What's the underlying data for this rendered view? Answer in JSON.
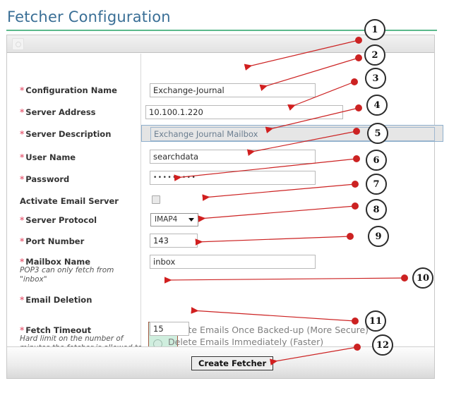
{
  "page": {
    "title": "Fetcher Configuration"
  },
  "toolbar": {
    "icon": "image-placeholder-icon"
  },
  "form": {
    "required_marker": "*",
    "fields": [
      {
        "label": "Configuration Name",
        "value": "Exchange-Journal",
        "required": true
      },
      {
        "label": "Server Address",
        "value": "10.100.1.220",
        "required": true
      },
      {
        "label": "Server Description",
        "value": "Exchange Journal Mailbox",
        "required": true,
        "focused": true
      },
      {
        "label": "User Name",
        "value": "searchdata",
        "required": true
      },
      {
        "label": "Password",
        "value": "•••••••••",
        "required": true
      },
      {
        "label": "Activate Email Server",
        "value": "",
        "required": false,
        "checked": false
      },
      {
        "label": "Server Protocol",
        "value": "IMAP4",
        "required": true
      },
      {
        "label": "Port Number",
        "value": "143",
        "required": true
      },
      {
        "label": "Mailbox Name",
        "value": "inbox",
        "required": true,
        "hint": "POP3 can only fetch from \"inbox\""
      },
      {
        "label": "Email Deletion",
        "value": "",
        "required": true
      },
      {
        "label": "Fetch Timeout",
        "value": "15",
        "required": true,
        "hint": "Hard limit on the number of minutes the fetcher is allowed to spend fetching one email."
      }
    ],
    "protocol_options": [
      "IMAP4"
    ],
    "deletion_options": [
      {
        "label": "Delete Emails Once Backed-up (More Secure)",
        "selected": true
      },
      {
        "label": "Delete Emails Immediately (Faster)",
        "selected": false
      }
    ]
  },
  "footer": {
    "submit_label": "Create Fetcher"
  },
  "annotations": {
    "accent_color": "#cc2222",
    "callouts": [
      {
        "number": "1"
      },
      {
        "number": "2"
      },
      {
        "number": "3"
      },
      {
        "number": "4"
      },
      {
        "number": "5"
      },
      {
        "number": "6"
      },
      {
        "number": "7"
      },
      {
        "number": "8"
      },
      {
        "number": "9"
      },
      {
        "number": "10"
      },
      {
        "number": "11"
      },
      {
        "number": "12"
      }
    ]
  },
  "colors": {
    "title": "#3a6f96",
    "title_rule": "#5bb98c",
    "required": "#e8697f",
    "highlight": "#cfeede",
    "annotation": "#cc2222"
  }
}
